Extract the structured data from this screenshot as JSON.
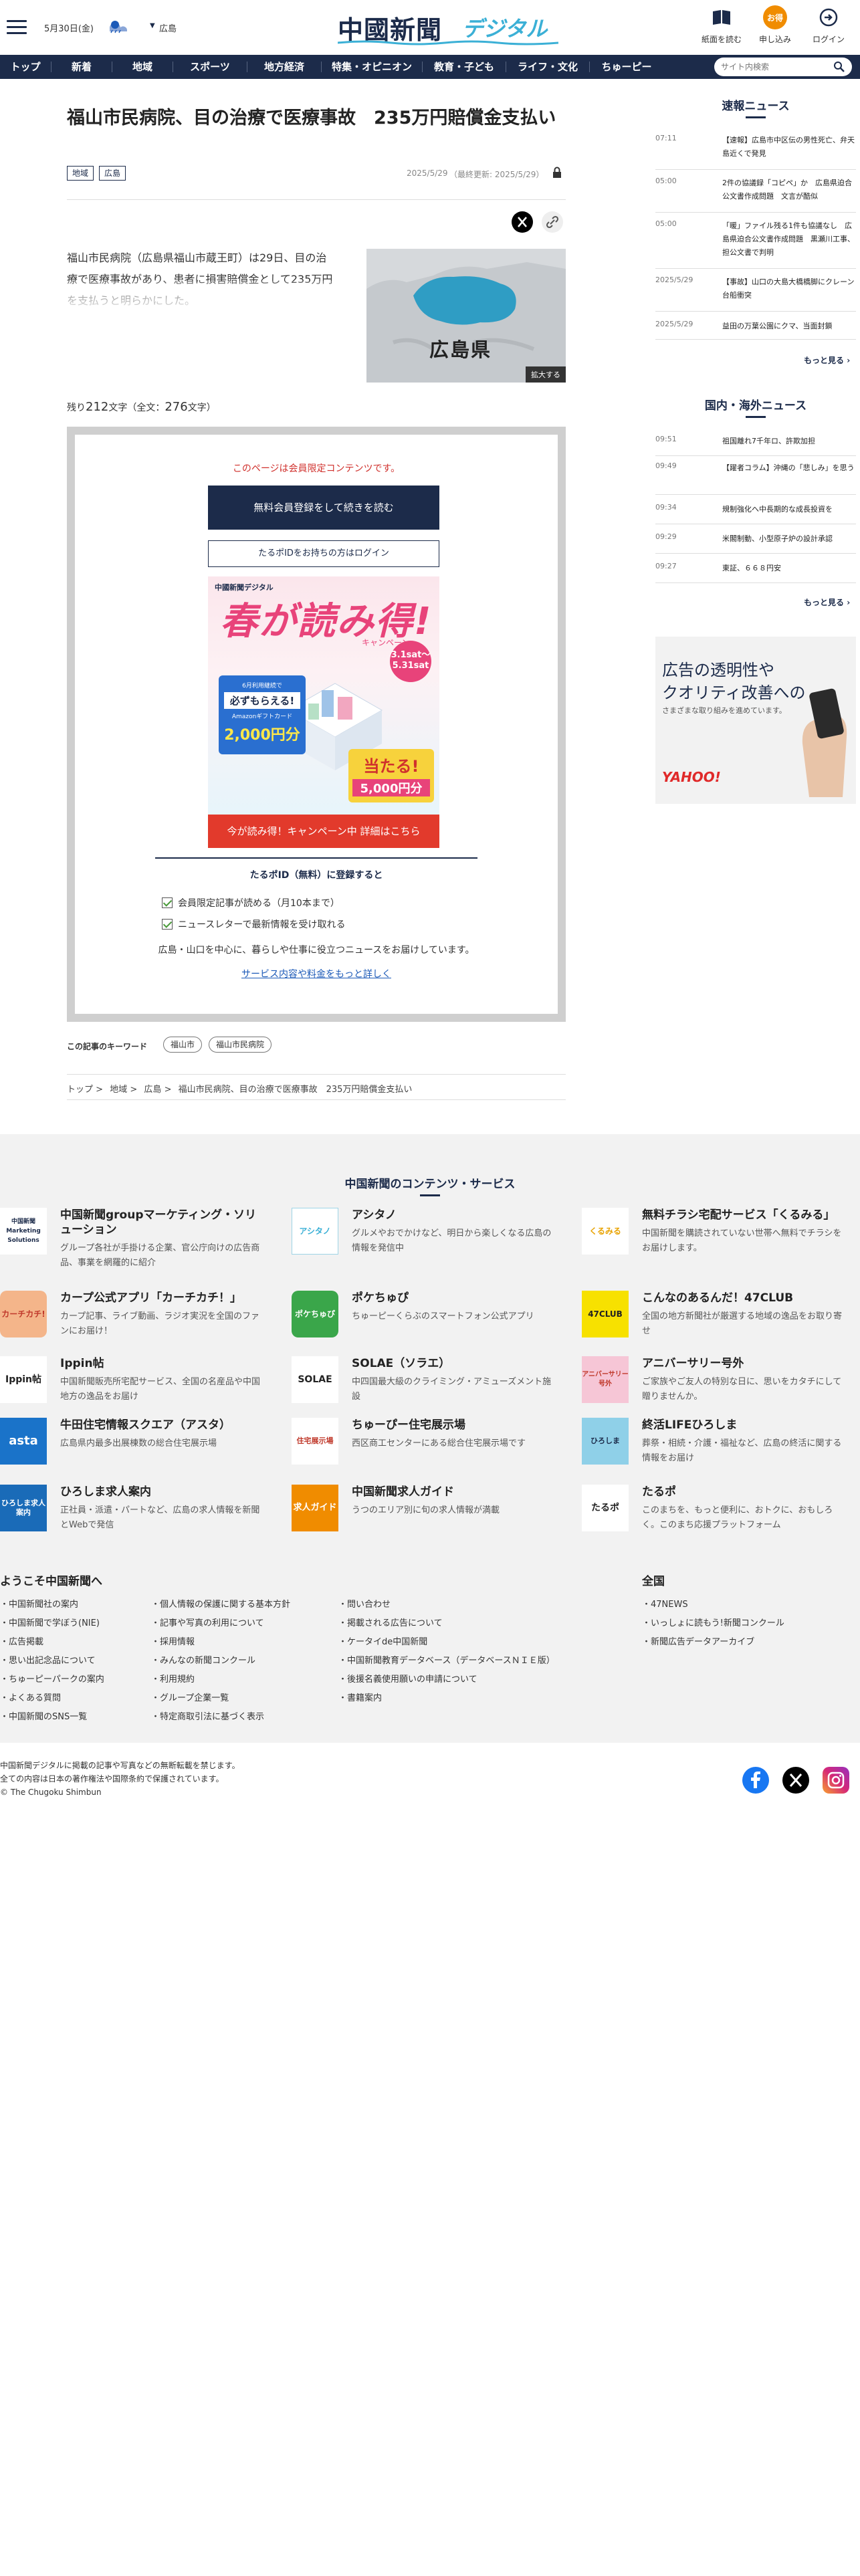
{
  "header": {
    "date": "5月30日(金)",
    "weather_location": "広島",
    "logo_main": "中國新聞",
    "logo_sub": "デジタル",
    "buttons": [
      {
        "label": "紙面を読む",
        "icon": "newspaper-icon"
      },
      {
        "label": "申し込み",
        "icon": "signup-icon",
        "icon_text": "お得"
      },
      {
        "label": "ログイン",
        "icon": "login-icon"
      }
    ],
    "search_placeholder": "サイト内検索"
  },
  "nav": [
    "トップ",
    "新着",
    "地域",
    "スポーツ",
    "地方経済",
    "特集・オピニオン",
    "教育・子ども",
    "ライフ・文化",
    "ちゅーピー"
  ],
  "article": {
    "title": "福山市民病院、目の治療で医療事故　235万円賠償金支払い",
    "tags": [
      "地域",
      "広島"
    ],
    "pubdate": "2025/5/29",
    "updated": "（最終更新: 2025/5/29）",
    "lead": "福山市民病院（広島県福山市蔵王町）は29日、目の治療で医療事故があり、患者に損害賠償金として235万円を支払うと明らかにした。",
    "map_label": "広島県",
    "enlarge": "拡大する",
    "remaining_prefix": "残り",
    "remaining_count": "212",
    "remaining_mid": "文字（全文：",
    "total_count": "276",
    "remaining_suffix": "文字）"
  },
  "paywall": {
    "message": "このページは会員限定コンテンツです。",
    "register_button": "無料会員登録をして続きを読む",
    "login_button": "たるポIDをお持ちの方はログイン",
    "banner": {
      "small": "中國新聞デジタル",
      "big": "春が読み得!",
      "campaign": "キャンペーン",
      "date": "3.1sat〜5.31sat",
      "amazon_1": "6月利用継続で",
      "amazon_2": "必ずもらえる!",
      "amazon_3": "Amazonギフトカード",
      "amazon_4": "2,000円分",
      "hit_1": "当たる!",
      "hit_2": "5,000円分"
    },
    "cta": "今が読み得！キャンペーン中 詳細はこちら",
    "tarupo_heading": "たるポID（無料）に登録すると",
    "benefits": [
      "会員限定記事が読める（月10本まで）",
      "ニュースレターで最新情報を受け取れる"
    ],
    "paragraph": "広島・山口を中心に、暮らしや仕事に役立つニュースをお届けしています。",
    "link": "サービス内容や料金をもっと詳しく"
  },
  "keywords": {
    "label": "この記事のキーワード",
    "items": [
      "福山市",
      "福山市民病院"
    ]
  },
  "breadcrumb": [
    "トップ",
    ">",
    "地域",
    ">",
    "広島",
    ">",
    "福山市民病院、目の治療で医療事故　235万円賠償金支払い"
  ],
  "sidebar": {
    "breaking_title": "速報ニュース",
    "breaking": [
      {
        "time": "07:11",
        "title": "【速報】広島市中区伝の男性死亡、弁天島近くで発見"
      },
      {
        "time": "05:00",
        "title": "2件の協議録「コピペ」か　広島県迫合公文書作成問題　文言が酷似"
      },
      {
        "time": "05:00",
        "title": "「暖」ファイル残る1件も協議なし　広島県迫合公文書作成問題　黒瀬川工事、担公文書で判明"
      },
      {
        "time": "2025/5/29",
        "title": "【事故】山口の大島大橋橋脚にクレーン台船衝突"
      },
      {
        "time": "2025/5/29",
        "title": "益田の万葉公園にクマ、当面封鎖"
      }
    ],
    "more1": "もっと見る",
    "domestic_title": "国内・海外ニュース",
    "domestic": [
      {
        "time": "09:51",
        "title": "祖国離れ7千年ロ、許欺加担"
      },
      {
        "time": "09:49",
        "title": "【躍者コラム】沖縄の「悲しみ」を思う"
      },
      {
        "time": "09:34",
        "title": "規制強化へ中長期的な成長投資を"
      },
      {
        "time": "09:29",
        "title": "米閣制動、小型原子炉の設計承認"
      },
      {
        "time": "09:27",
        "title": "東証、６６８円安"
      }
    ],
    "more2": "もっと見る",
    "ad": {
      "line1": "広告の透明性や",
      "line2": "クオリティ改善への",
      "line3": "さまざまな取り組みを進めています。",
      "brand": "YAHOO!"
    }
  },
  "services": {
    "heading": "中国新聞のコンテンツ・サービス",
    "items": [
      {
        "logo": "中国新聞 Marketing Solutions",
        "name": "中国新聞groupマーケティング・ソリューション",
        "desc": "グループ各社が手掛ける企業、官公庁向けの広告商品、事業を網羅的に紹介"
      },
      {
        "logo": "アシタノ",
        "name": "アシタノ",
        "desc": "グルメやおでかけなど、明日から楽しくなる広島の情報を発信中"
      },
      {
        "logo": "くるみる",
        "name": "無料チラシ宅配サービス「くるみる」",
        "desc": "中国新聞を購読されていない世帯へ無料でチラシをお届けします。"
      },
      {
        "logo": "カーチカチ!",
        "name": "カープ公式アプリ「カーチカチ！」",
        "desc": "カープ記事、ライブ動画、ラジオ実況を全国のファンにお届け！"
      },
      {
        "logo": "ポケちゅぴ",
        "name": "ポケちゅぴ",
        "desc": "ちゅーピーくらぶのスマートフォン公式アプリ"
      },
      {
        "logo": "47CLUB",
        "name": "こんなのあるんだ！47CLUB",
        "desc": "全国の地方新聞社が厳選する地域の逸品をお取り寄せ"
      },
      {
        "logo": "Ippin帖",
        "name": "Ippin帖",
        "desc": "中国新聞販売所宅配サービス、全国の名産品や中国地方の逸品をお届け"
      },
      {
        "logo": "SOLAE",
        "name": "SOLAE（ソラエ）",
        "desc": "中四国最大級のクライミング・アミューズメント施設"
      },
      {
        "logo": "アニバーサリー号外",
        "name": "アニバーサリー号外",
        "desc": "ご家族やご友人の特別な日に、思いをカタチにして贈りませんか。"
      },
      {
        "logo": "asta",
        "name": "牛田住宅情報スクエア（アスタ）",
        "desc": "広島県内最多出展棟数の総合住宅展示場"
      },
      {
        "logo": "住宅展示場",
        "name": "ちゅーぴー住宅展示場",
        "desc": "西区商工センターにある総合住宅展示場です"
      },
      {
        "logo": "ひろしま",
        "name": "終活LIFEひろしま",
        "desc": "葬祭・相続・介護・福祉など、広島の終活に関する情報をお届け"
      },
      {
        "logo": "ひろしま求人案内",
        "name": "ひろしま求人案内",
        "desc": "正社員・派遣・パートなど、広島の求人情報を新聞とWebで発信"
      },
      {
        "logo": "求人ガイド",
        "name": "中国新聞求人ガイド",
        "desc": "うつのエリア別に旬の求人情報が満載"
      },
      {
        "logo": "たるポ",
        "name": "たるポ",
        "desc": "このまちを、もっと便利に、おトクに、おもしろく。このまち応援プラットフォーム"
      }
    ]
  },
  "footer": {
    "welcome": "ようこそ中国新聞へ",
    "zenkoku": "全国",
    "col1": [
      "・中国新聞社の案内",
      "・中国新聞で学ぼう(NIE)",
      "・広告掲載",
      "・思い出記念品について",
      "・ちゅーピーパークの案内",
      "・よくある質問",
      "・中国新聞のSNS一覧"
    ],
    "col2": [
      "・個人情報の保護に関する基本方針",
      "・記事や写真の利用について",
      "・採用情報",
      "・みんなの新聞コンクール",
      "・利用規約",
      "・グループ企業一覧",
      "・特定商取引法に基づく表示"
    ],
    "col3": [
      "・問い合わせ",
      "・掲載される広告について",
      "・ケータイde中国新聞",
      "・中国新聞教育データベース（データベースＮＩＥ版）",
      "・後援名義使用願いの申請について",
      "・書籍案内"
    ],
    "col4": [
      "・47NEWS",
      "・いっしょに読もう!新聞コンクール",
      "・新聞広告データアーカイブ"
    ],
    "copy1": "中国新聞デジタルに掲載の記事や写真などの無断転載を禁じます。",
    "copy2": "全ての内容は日本の著作権法や国際条約で保護されています。",
    "copy3": "© The Chugoku Shimbun"
  },
  "colors": {
    "navy": "#1c2b4a",
    "accent_orange": "#f08c00",
    "cta_red": "#e23a2c",
    "logo_blue": "#3bb0d6"
  }
}
